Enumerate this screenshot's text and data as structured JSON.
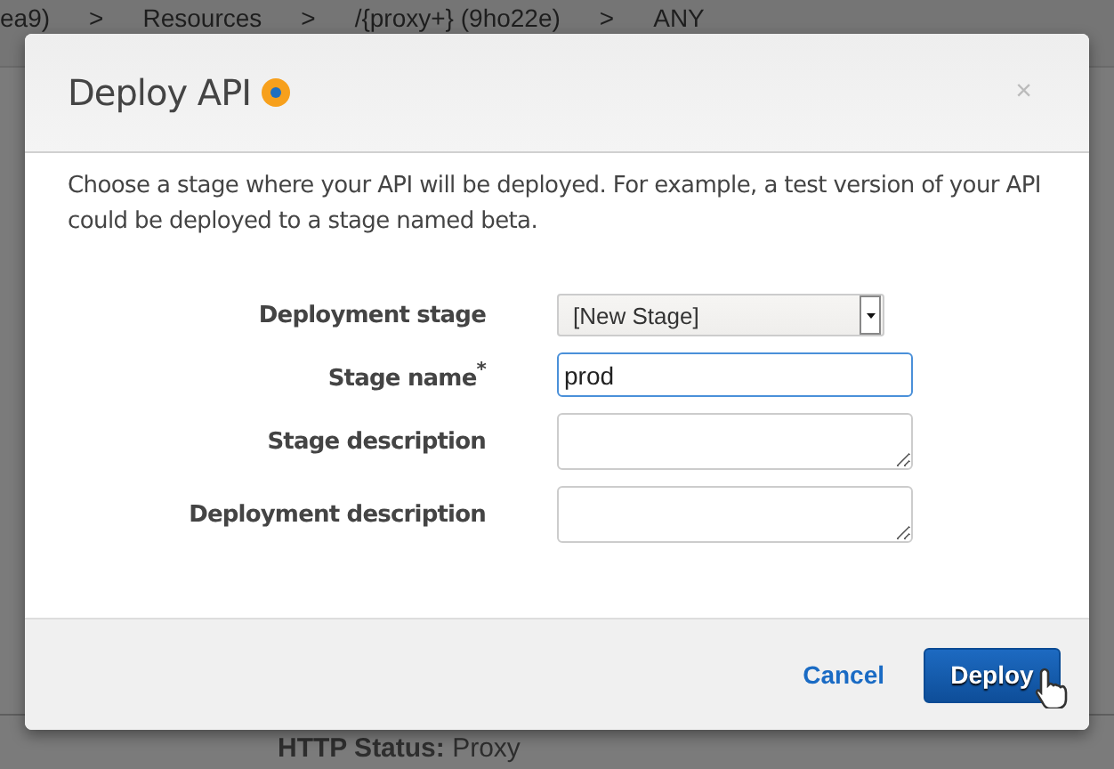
{
  "breadcrumb": {
    "separator": ">",
    "items": [
      {
        "label": "ea9)"
      },
      {
        "label": "Resources"
      },
      {
        "label": "/{proxy+} (9ho22e)"
      },
      {
        "label": "ANY"
      }
    ]
  },
  "background_status": {
    "label": "HTTP Status:",
    "value": "Proxy"
  },
  "dialog": {
    "title": "Deploy API",
    "close": "×",
    "description": "Choose a stage where your API will be deployed. For example, a test version of your API could be deployed to a stage named beta.",
    "fields": [
      {
        "kind": "select",
        "label": "Deployment stage",
        "value": "[New Stage]",
        "focused": false
      },
      {
        "kind": "text",
        "label": "Stage name$^{*}$",
        "value": "prod",
        "focused": true
      },
      {
        "kind": "textarea",
        "label": "Stage description",
        "focused": false
      },
      {
        "kind": "textarea",
        "label": "Deployment description",
        "focused": false
      }
    ],
    "cancel": "Cancel",
    "deploy": "Deploy"
  }
}
